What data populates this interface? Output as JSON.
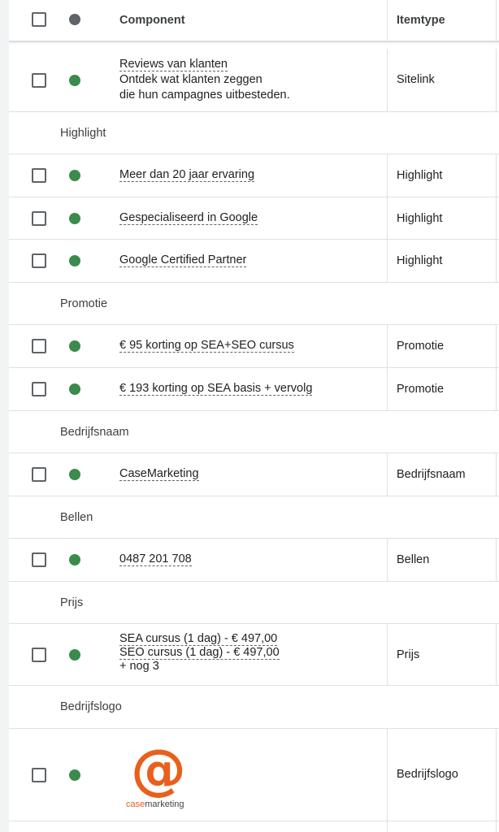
{
  "header": {
    "component_label": "Component",
    "itemtype_label": "Itemtype"
  },
  "colors": {
    "status_enabled": "#3b8a4e",
    "status_header": "#5f6368",
    "logo_orange": "#e8601c"
  },
  "rows": {
    "r0": {
      "lines": [
        "Reviews van klanten",
        "Ontdek wat klanten zeggen",
        "die hun campagnes uitbesteden."
      ],
      "itemtype": "Sitelink"
    },
    "g_highlight": "Highlight",
    "r1": {
      "text": "Meer dan 20 jaar ervaring",
      "itemtype": "Highlight"
    },
    "r2": {
      "text": "Gespecialiseerd in Google",
      "itemtype": "Highlight"
    },
    "r3": {
      "text": "Google Certified Partner",
      "itemtype": "Highlight"
    },
    "g_promotie": "Promotie",
    "r4": {
      "text": "€ 95 korting op SEA+SEO cursus",
      "itemtype": "Promotie"
    },
    "r5": {
      "text": "€ 193 korting op SEA basis + vervolg",
      "itemtype": "Promotie"
    },
    "g_bedrijfsnaam": "Bedrijfsnaam",
    "r6": {
      "text": "CaseMarketing",
      "itemtype": "Bedrijfsnaam"
    },
    "g_bellen": "Bellen",
    "r7": {
      "text": "0487 201 708",
      "itemtype": "Bellen"
    },
    "g_prijs": "Prijs",
    "r8": {
      "lines": [
        "SEA cursus (1 dag) - € 497,00",
        "SEO cursus (1 dag) - € 497,00",
        "+ nog 3"
      ],
      "itemtype": "Prijs"
    },
    "g_bedrijfslogo": "Bedrijfslogo",
    "r9": {
      "logo_symbol": "@",
      "logo_case": "case",
      "logo_marketing": "marketing",
      "itemtype": "Bedrijfslogo"
    }
  }
}
